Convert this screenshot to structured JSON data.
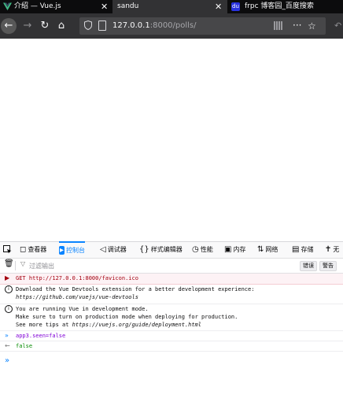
{
  "tabs": [
    {
      "title": "介绍 — Vue.js",
      "close": "✕"
    },
    {
      "title": "sandu",
      "close": "✕"
    },
    {
      "title": "frpc 博客园_百度搜索",
      "close": "✕",
      "favicon": "du"
    }
  ],
  "nav": {
    "back": "←",
    "forward": "→",
    "reload": "↻",
    "home": "⌂",
    "url_host": "127.0.0.1",
    "url_rest": ":8000/polls/",
    "more": "···",
    "star": "☆",
    "undo": "↶"
  },
  "devtools": {
    "tabs": [
      {
        "icon": "◻",
        "label": "查看器"
      },
      {
        "icon": "▸",
        "label": "控制台"
      },
      {
        "icon": "◁",
        "label": "调试器"
      },
      {
        "icon": "{}",
        "label": "样式编辑器"
      },
      {
        "icon": "◷",
        "label": "性能"
      },
      {
        "icon": "▣",
        "label": "内存"
      },
      {
        "icon": "⇅",
        "label": "网络"
      },
      {
        "icon": "▤",
        "label": "存储"
      },
      {
        "icon": "✝",
        "label": "无"
      }
    ],
    "filter": {
      "placeholder": "过滤输出",
      "trash": "🗑",
      "funnel": "▽"
    },
    "filter_buttons": [
      "错误",
      "警告"
    ],
    "messages": [
      {
        "type": "error",
        "gutter": "▶",
        "text": "GET http://127.0.0.1:8000/favicon.ico"
      },
      {
        "type": "info",
        "gutter": "i",
        "line1": "Download the Vue Devtools extension for a better development experience:",
        "line2": "https://github.com/vuejs/vue-devtools"
      },
      {
        "type": "info",
        "gutter": "i",
        "line1": "You are running Vue in development mode.",
        "line2": "Make sure to turn on production mode when deploying for production.",
        "line3_prefix": "See more tips at ",
        "line3_link": "https://vuejs.org/guide/deployment.html"
      },
      {
        "type": "command",
        "gutter": "»",
        "text": "app3.seen=false"
      },
      {
        "type": "result",
        "gutter": "←",
        "text": "false"
      }
    ],
    "prompt": "»"
  },
  "colors": {
    "accent": "#0a84ff",
    "tabbar": "#0c0c0d",
    "toolbar": "#323234",
    "error_bg": "#fdf2f5"
  }
}
